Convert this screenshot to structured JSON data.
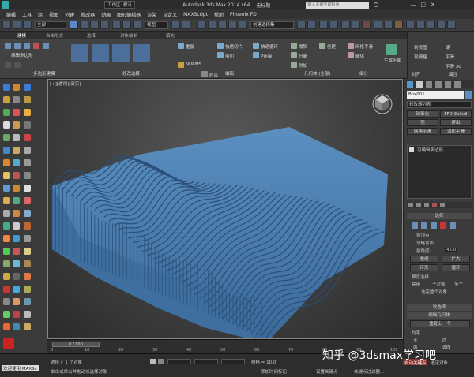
{
  "titlebar": {
    "workspace_label": "工作区: 默认",
    "app_title": "Autodesk 3ds Max  2014 x64",
    "doc_title": "无标题",
    "search_placeholder": "键入关键字或短语"
  },
  "menu": [
    "编辑",
    "工具",
    "组",
    "视图",
    "创建",
    "修改器",
    "动画",
    "图形编辑器",
    "渲染",
    "自定义",
    "MAXScript",
    "帮助",
    "Phoenix FD"
  ],
  "toolbar": {
    "selection_filter": "全部",
    "view_dropdown": "视图",
    "selection_set": "创建选择集"
  },
  "ribbon_tabs": [
    "建模",
    "自由形式",
    "选择",
    "对象绘制",
    "填充"
  ],
  "ribbon": {
    "group_labels": [
      "多边形建模",
      "修改选择",
      "编辑",
      "几何体 (全部)",
      "细分",
      "对齐",
      "属性"
    ],
    "poly_label": "编辑多边形",
    "edit_items": [
      "重复",
      "快速切片",
      "快速循环",
      "剪切",
      "平滑",
      "切角",
      "挤出",
      "插入",
      "P连接",
      "网格平滑",
      "细化",
      "分离",
      "附加",
      "塌陷",
      "创建",
      "约束",
      "NURMS"
    ],
    "align_items": [
      "生成平面",
      "到视图",
      "到栅格"
    ],
    "props_items": [
      "硬",
      "平滑",
      "平滑 30"
    ]
  },
  "viewport": {
    "label": "[+][透视][真实]"
  },
  "cmdpanel": {
    "object_name": "Box001",
    "modifier_list": "修改器列表",
    "buttons": [
      "球形化",
      "FFD 3x3x3",
      "壳",
      "挤出",
      "网格平滑",
      "涡轮平滑"
    ],
    "stack_item": "可编辑多边形",
    "rollout_selection": "选择",
    "sel_options": [
      "按顶点",
      "忽略背面",
      "按角度:",
      "45.0"
    ],
    "shrink": "收缩",
    "grow": "扩大",
    "ring": "环形",
    "loop": "循环",
    "preview_title": "预览选择",
    "preview_opts": [
      "禁用",
      "子对象",
      "多个"
    ],
    "selected_count": "选定整个对象",
    "soft_sel": "软选择",
    "edit_geom": "编辑几何体",
    "repeat_last": "重复上一个",
    "constraint": "约束",
    "constraint_opts": [
      "无",
      "边",
      "面",
      "法线"
    ]
  },
  "timeline": {
    "frame_counter": "0 / 100",
    "ticks": [
      "0",
      "10",
      "20",
      "30",
      "40",
      "50",
      "60",
      "70",
      "80",
      "90",
      "100"
    ]
  },
  "status": {
    "welcome": "欢迎使用 MAXSc",
    "selected": "选择了 1 个对象",
    "hint": "单击或单击并拖动以选择对象",
    "grid": "栅格 = 10.0",
    "add_time_tag": "添加时间标记",
    "set_key": "设置关键点",
    "key_filter": "关键点过滤器...",
    "auto_key": "自动关键点",
    "selected_obj": "选定对象"
  },
  "watermark": "知乎 @3dsmax学习吧",
  "colors": {
    "accent_blue": "#4a7fc1",
    "wave_blue": "#5b8fc0",
    "bg_dark": "#3a3a3a"
  }
}
